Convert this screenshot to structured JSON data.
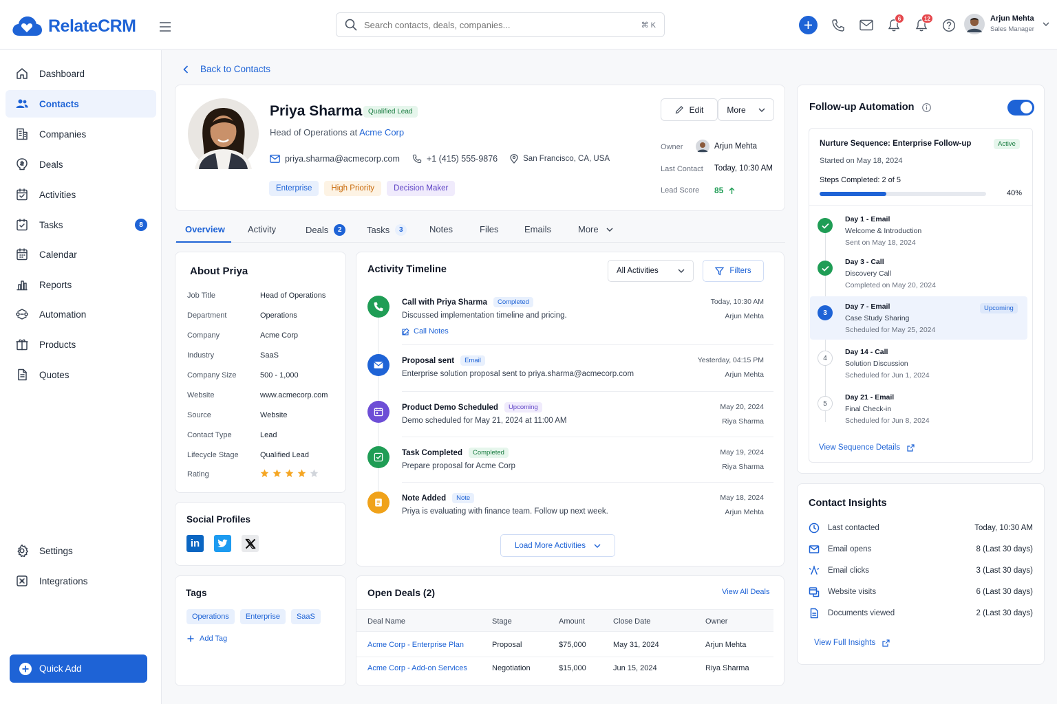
{
  "app": {
    "name": "RelateCRM"
  },
  "search": {
    "placeholder": "Search contacts, deals, companies...",
    "shortcut": "⌘ K"
  },
  "header": {
    "mail_badge": "6",
    "bell_badge": "12",
    "user_name": "Arjun Mehta",
    "user_role": "Sales Manager"
  },
  "sidebar": {
    "items": [
      {
        "label": "Dashboard",
        "icon": "home-icon"
      },
      {
        "label": "Contacts",
        "icon": "users-icon",
        "active": true
      },
      {
        "label": "Companies",
        "icon": "building-icon"
      },
      {
        "label": "Deals",
        "icon": "deals-icon"
      },
      {
        "label": "Activities",
        "icon": "activity-icon"
      },
      {
        "label": "Tasks",
        "icon": "tasks-icon",
        "badge": "8"
      },
      {
        "label": "Calendar",
        "icon": "calendar-icon"
      },
      {
        "label": "Reports",
        "icon": "reports-icon"
      },
      {
        "label": "Automation",
        "icon": "automation-icon"
      },
      {
        "label": "Products",
        "icon": "products-icon"
      },
      {
        "label": "Quotes",
        "icon": "quotes-icon"
      }
    ],
    "bottom": [
      {
        "label": "Settings",
        "icon": "settings-icon"
      },
      {
        "label": "Integrations",
        "icon": "integrations-icon"
      }
    ],
    "quick_add": "Quick Add"
  },
  "back": "Back to Contacts",
  "contact": {
    "name": "Priya Sharma",
    "status": "Qualified Lead",
    "title_prefix": "Head of Operations at ",
    "company": "Acme Corp",
    "email": "priya.sharma@acmecorp.com",
    "phone": "+1 (415) 555-9876",
    "location": "San Francisco, CA, USA",
    "tags": [
      "Enterprise",
      "High Priority",
      "Decision Maker"
    ],
    "edit": "Edit",
    "more": "More",
    "owner_label": "Owner",
    "owner": "Arjun Mehta",
    "last_contact_label": "Last Contact",
    "last_contact": "Today, 10:30 AM",
    "lead_score_label": "Lead Score",
    "lead_score": "85"
  },
  "tabs": [
    {
      "label": "Overview",
      "active": true
    },
    {
      "label": "Activity"
    },
    {
      "label": "Deals",
      "badge": "2"
    },
    {
      "label": "Tasks",
      "badge": "3"
    },
    {
      "label": "Notes"
    },
    {
      "label": "Files"
    },
    {
      "label": "Emails"
    },
    {
      "label": "More"
    }
  ],
  "about": {
    "title": "About Priya",
    "rows": [
      {
        "label": "Job Title",
        "value": "Head of Operations"
      },
      {
        "label": "Department",
        "value": "Operations"
      },
      {
        "label": "Company",
        "value": "Acme Corp",
        "link": true
      },
      {
        "label": "Industry",
        "value": "SaaS"
      },
      {
        "label": "Company Size",
        "value": "500 - 1,000"
      },
      {
        "label": "Website",
        "value": "www.acmecorp.com",
        "link": true
      },
      {
        "label": "Source",
        "value": "Website"
      },
      {
        "label": "Contact Type",
        "value": "Lead"
      },
      {
        "label": "Lifecycle Stage",
        "value": "Qualified Lead"
      }
    ],
    "rating_label": "Rating",
    "rating": 4,
    "rating_max": 5
  },
  "social": {
    "title": "Social Profiles",
    "items": [
      "linkedin-icon",
      "twitter-icon",
      "x-icon"
    ]
  },
  "tags_card": {
    "title": "Tags",
    "tags": [
      "Operations",
      "Enterprise",
      "SaaS"
    ],
    "add": "Add Tag"
  },
  "timeline": {
    "title": "Activity Timeline",
    "filter": "All Activities",
    "filters_btn": "Filters",
    "load_more": "Load More Activities",
    "items": [
      {
        "title": "Call with Priya Sharma",
        "badge": "Completed",
        "badge_color": "blue",
        "desc": "Discussed implementation timeline and pricing.",
        "time": "Today, 10:30 AM",
        "who": "Arjun Mehta",
        "link": "Call Notes",
        "icon_color": "#1f9d55"
      },
      {
        "title": "Proposal sent",
        "badge": "Email",
        "badge_color": "blue",
        "desc": "Enterprise solution proposal sent to priya.sharma@acmecorp.com",
        "time": "Yesterday, 04:15 PM",
        "who": "Arjun Mehta",
        "icon_color": "#1e63d6"
      },
      {
        "title": "Product Demo Scheduled",
        "badge": "Upcoming",
        "badge_color": "purple",
        "desc": "Demo scheduled for May 21, 2024 at 11:00 AM",
        "time": "May 20, 2024",
        "who": "Riya Sharma",
        "icon_color": "#6d4ed6"
      },
      {
        "title": "Task Completed",
        "badge": "Completed",
        "badge_color": "green",
        "desc": "Prepare proposal for Acme Corp",
        "time": "May 19, 2024",
        "who": "Riya Sharma",
        "icon_color": "#1f9d55"
      },
      {
        "title": "Note Added",
        "badge": "Note",
        "badge_color": "blue",
        "desc": "Priya is evaluating with finance team. Follow up next week.",
        "time": "May 18, 2024",
        "who": "Arjun Mehta",
        "icon_color": "#f0a21a"
      }
    ]
  },
  "deals": {
    "title": "Open Deals (2)",
    "view_all": "View All Deals",
    "headers": [
      "Deal Name",
      "Stage",
      "Amount",
      "Close Date",
      "Owner"
    ],
    "rows": [
      [
        "Acme Corp - Enterprise Plan",
        "Proposal",
        "$75,000",
        "May 31, 2024",
        "Arjun Mehta"
      ],
      [
        "Acme Corp - Add-on Services",
        "Negotiation",
        "$15,000",
        "Jun 15, 2024",
        "Riya Sharma"
      ]
    ]
  },
  "automation": {
    "title": "Follow-up Automation",
    "enabled": true,
    "sequence": "Nurture Sequence: Enterprise Follow-up",
    "status": "Active",
    "started": "Started on May 18, 2024",
    "steps_label": "Steps Completed: 2 of 5",
    "progress": 40,
    "progress_text": "40%",
    "steps": [
      {
        "n": "1",
        "title": "Day 1 - Email",
        "sub": "Welcome & Introduction",
        "meta": "Sent on May 18, 2024",
        "state": "done"
      },
      {
        "n": "2",
        "title": "Day 3 - Call",
        "sub": "Discovery Call",
        "meta": "Completed on May 20, 2024",
        "state": "done"
      },
      {
        "n": "3",
        "title": "Day 7 - Email",
        "sub": "Case Study Sharing",
        "meta": "Scheduled for May 25, 2024",
        "state": "current",
        "badge": "Upcoming"
      },
      {
        "n": "4",
        "title": "Day 14 - Call",
        "sub": "Solution Discussion",
        "meta": "Scheduled for Jun 1, 2024",
        "state": "pending"
      },
      {
        "n": "5",
        "title": "Day 21 - Email",
        "sub": "Final Check-in",
        "meta": "Scheduled for Jun 8, 2024",
        "state": "pending"
      }
    ],
    "view_details": "View Sequence Details"
  },
  "insights": {
    "title": "Contact Insights",
    "rows": [
      {
        "label": "Last contacted",
        "value": "Today, 10:30 AM",
        "icon": "clock-icon"
      },
      {
        "label": "Email opens",
        "value": "8 (Last 30 days)",
        "icon": "mail-icon"
      },
      {
        "label": "Email clicks",
        "value": "3 (Last 30 days)",
        "icon": "cursor-icon"
      },
      {
        "label": "Website visits",
        "value": "6 (Last 30 days)",
        "icon": "globe-icon"
      },
      {
        "label": "Documents viewed",
        "value": "2 (Last 30 days)",
        "icon": "document-icon"
      }
    ],
    "view_full": "View Full Insights"
  },
  "colors": {
    "accent": "#1e63d6",
    "green": "#1f9d55"
  }
}
